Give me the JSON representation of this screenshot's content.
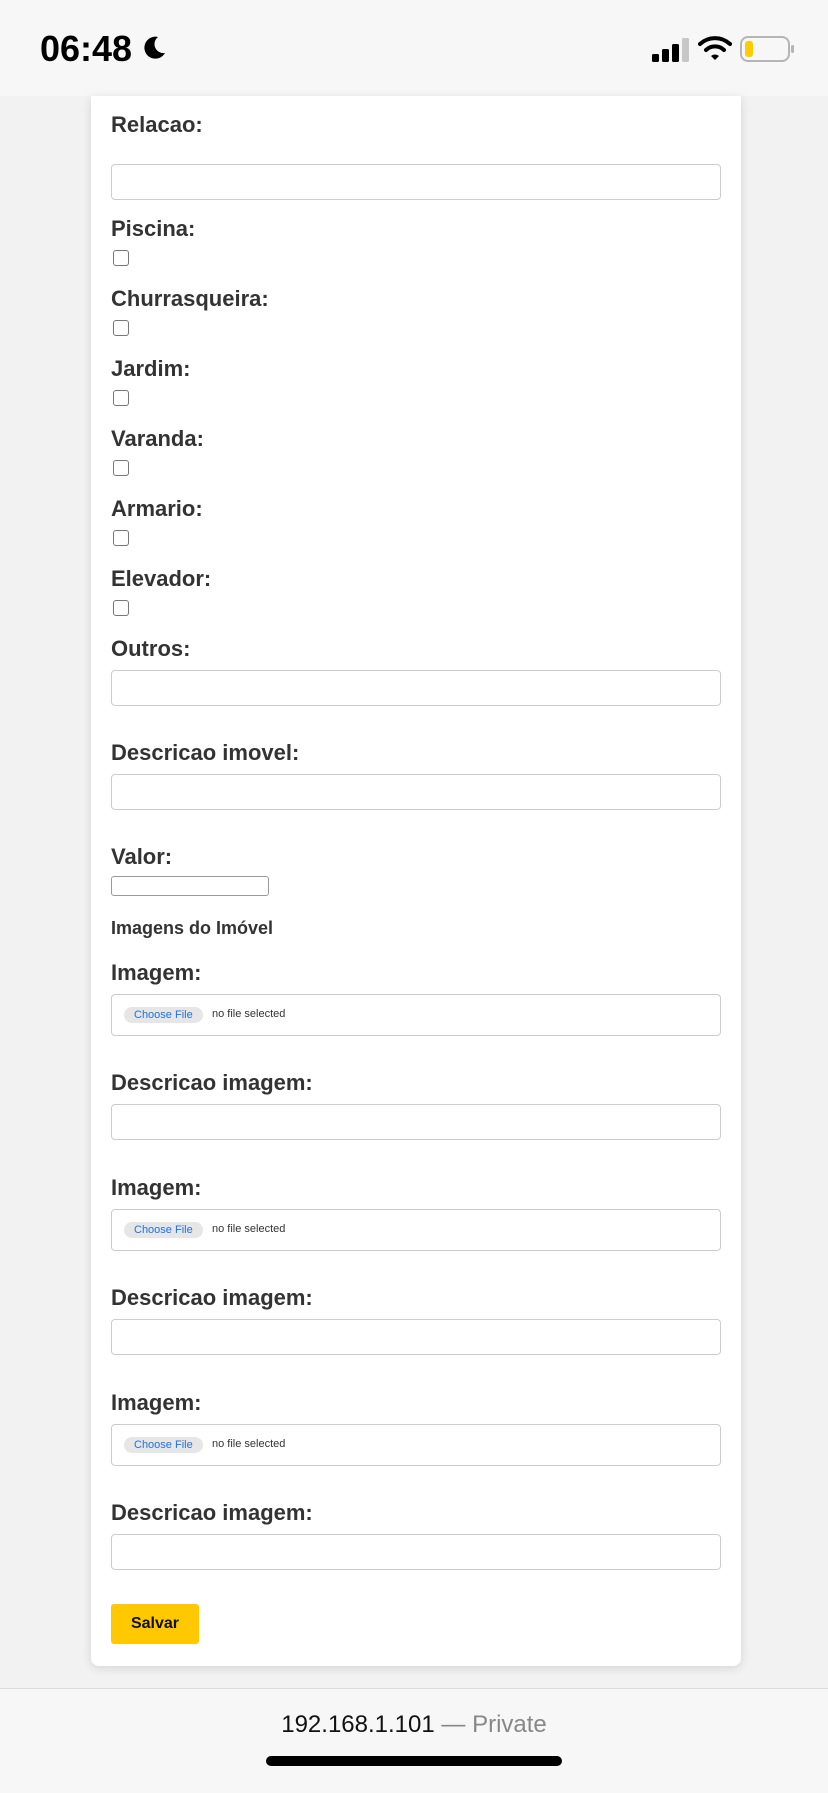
{
  "status": {
    "time": "06:48"
  },
  "form": {
    "relacao_label": "Relacao:",
    "piscina_label": "Piscina:",
    "churrasqueira_label": "Churrasqueira:",
    "jardim_label": "Jardim:",
    "varanda_label": "Varanda:",
    "armario_label": "Armario:",
    "elevador_label": "Elevador:",
    "outros_label": "Outros:",
    "descricao_imovel_label": "Descricao imovel:",
    "valor_label": "Valor:",
    "imagens_title": "Imagens do Imóvel",
    "images": [
      {
        "label": "Imagem:",
        "choose": "Choose File",
        "status": "no file selected",
        "desc_label": "Descricao imagem:"
      },
      {
        "label": "Imagem:",
        "choose": "Choose File",
        "status": "no file selected",
        "desc_label": "Descricao imagem:"
      },
      {
        "label": "Imagem:",
        "choose": "Choose File",
        "status": "no file selected",
        "desc_label": "Descricao imagem:"
      }
    ],
    "save_label": "Salvar"
  },
  "urlbar": {
    "host": "192.168.1.101",
    "separator": " — ",
    "mode": "Private"
  }
}
